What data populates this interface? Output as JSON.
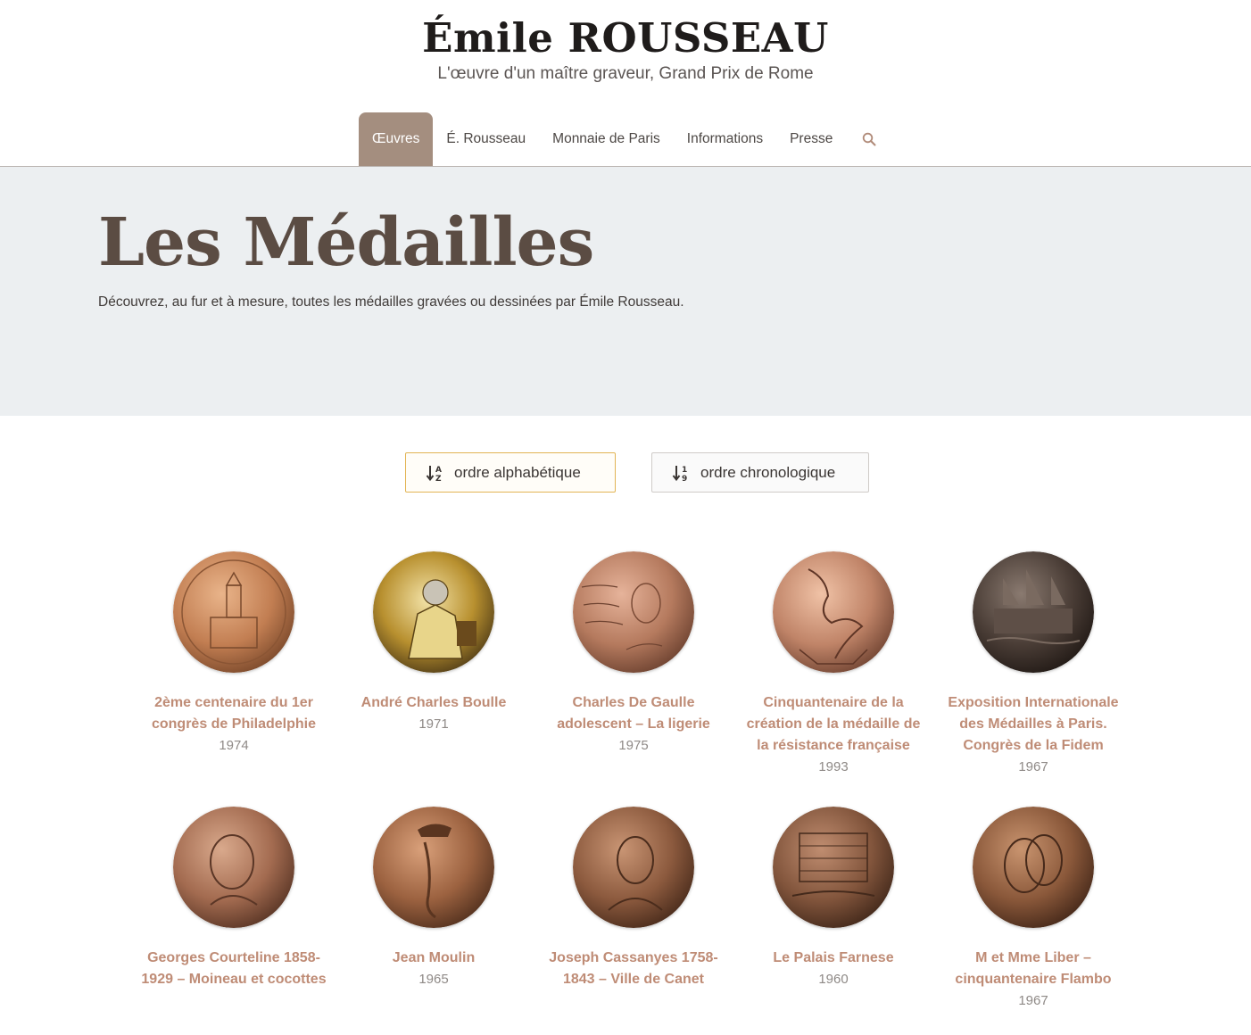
{
  "header": {
    "title": "Émile ROUSSEAU",
    "tagline": "L'œuvre d'un maître graveur, Grand Prix de Rome"
  },
  "nav": {
    "items": [
      {
        "label": "Œuvres",
        "active": true
      },
      {
        "label": "É. Rousseau",
        "active": false
      },
      {
        "label": "Monnaie de Paris",
        "active": false
      },
      {
        "label": "Informations",
        "active": false
      },
      {
        "label": "Presse",
        "active": false
      }
    ],
    "search_icon": "search-icon"
  },
  "hero": {
    "title": "Les Médailles",
    "description": "Découvrez, au fur et à mesure, toutes les médailles gravées ou dessinées par Émile Rousseau."
  },
  "sort": {
    "alpha_label": "ordre alphabétique",
    "chrono_label": "ordre chronologique",
    "active": "alpha"
  },
  "medals": [
    {
      "title": "2ème centenaire du 1er congrès de Philadelphie",
      "year": "1974"
    },
    {
      "title": "André Charles Boulle",
      "year": "1971"
    },
    {
      "title": "Charles De Gaulle adolescent – La ligerie",
      "year": "1975"
    },
    {
      "title": "Cinquantenaire de la création de la médaille de la résistance française",
      "year": "1993"
    },
    {
      "title": "Exposition Internationale des Médailles à Paris. Congrès de la Fidem",
      "year": "1967"
    },
    {
      "title": "Georges Courteline 1858-1929 – Moineau et cocottes",
      "year": ""
    },
    {
      "title": "Jean Moulin",
      "year": "1965"
    },
    {
      "title": "Joseph Cassanyes 1758-1843 – Ville de Canet",
      "year": ""
    },
    {
      "title": "Le Palais Farnese",
      "year": "1960"
    },
    {
      "title": "M et Mme Liber – cinquantenaire Flambo",
      "year": "1967"
    }
  ],
  "colors": {
    "nav_active_bg": "#a48e7f",
    "hero_bg": "#eceff1",
    "hero_title": "#5b4c43",
    "medal_title": "#bf8c76",
    "sort_active_border": "#e2b454"
  }
}
